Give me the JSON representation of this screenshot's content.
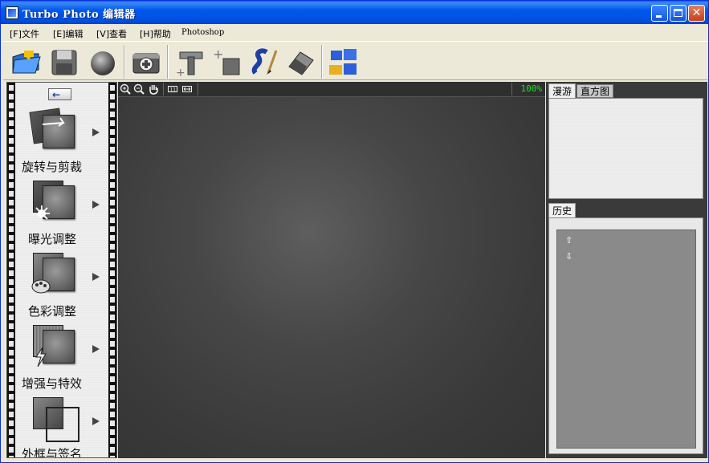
{
  "window": {
    "title": "Turbo Photo 编辑器",
    "controls": {
      "minimize": "",
      "maximize": "",
      "close": "✕"
    }
  },
  "menu": {
    "items": [
      "[F]文件",
      "[E]编辑",
      "[V]查看",
      "[H]帮助",
      "Photoshop"
    ]
  },
  "toolbar": {
    "icons": [
      "open-folder-icon",
      "save-disk-icon",
      "sphere-icon",
      "camera-icon",
      "text-tool-icon",
      "add-image-icon",
      "brush-tool-icon",
      "eraser-icon",
      "windows-icon"
    ]
  },
  "left_panel": {
    "back_label": "←",
    "tools": [
      {
        "label": "旋转与剪裁",
        "icon": "rotate-crop-icon"
      },
      {
        "label": "曝光调整",
        "icon": "exposure-icon"
      },
      {
        "label": "色彩调整",
        "icon": "color-palette-icon"
      },
      {
        "label": "增强与特效",
        "icon": "effects-icon"
      },
      {
        "label": "外框与签名",
        "icon": "frame-icon"
      }
    ]
  },
  "canvas": {
    "zoom": "100%",
    "tools": [
      "zoom-in-icon",
      "zoom-out-icon",
      "hand-icon",
      "actual-size-icon",
      "fit-width-icon"
    ]
  },
  "right_panel": {
    "nav_tabs": [
      "漫游",
      "直方图"
    ],
    "history_tab": "历史",
    "scroll_up": "⇧",
    "scroll_down": "⇩"
  },
  "colors": {
    "titlebar": "#0058ee",
    "zoom_text": "#22dd22",
    "canvas_bg": "#474747"
  }
}
